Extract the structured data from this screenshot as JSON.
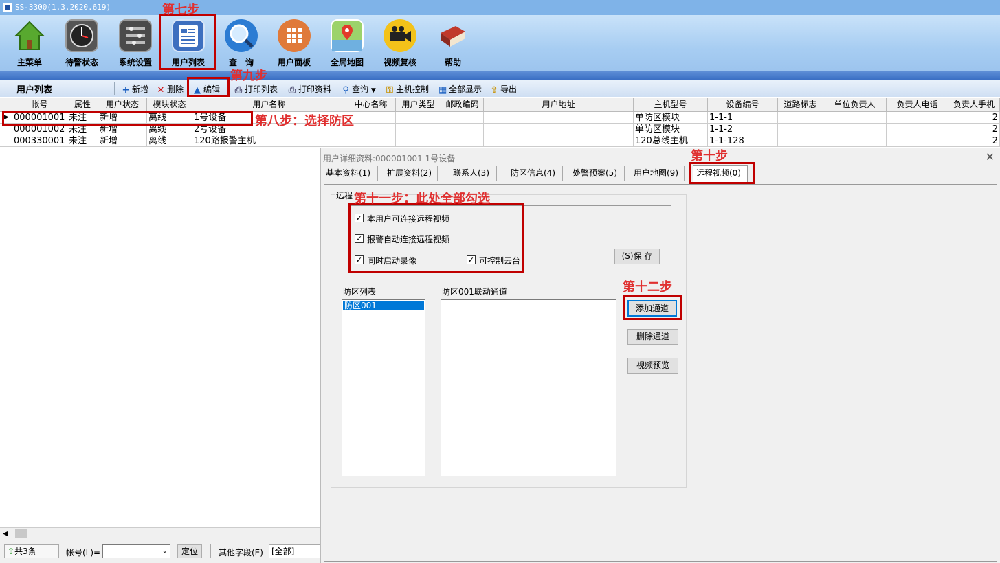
{
  "window": {
    "title": "SS-3300(1.3.2020.619)"
  },
  "ribbon": {
    "items": [
      {
        "label": "主菜单",
        "icon": "home-icon"
      },
      {
        "label": "待警状态",
        "icon": "clock-icon"
      },
      {
        "label": "系统设置",
        "icon": "settings-icon"
      },
      {
        "label": "用户列表",
        "icon": "user-list-icon"
      },
      {
        "label": "查　询",
        "icon": "search-icon"
      },
      {
        "label": "用户面板",
        "icon": "grid-panel-icon"
      },
      {
        "label": "全局地图",
        "icon": "map-icon"
      },
      {
        "label": "视频复核",
        "icon": "video-camera-icon"
      },
      {
        "label": "帮助",
        "icon": "book-icon"
      }
    ]
  },
  "toolbar": {
    "title": "用户列表",
    "buttons": [
      "新增",
      "删除",
      "编辑",
      "打印列表",
      "打印资料",
      "查询",
      "主机控制",
      "全部显示",
      "导出"
    ]
  },
  "grid": {
    "columns": [
      "帐号",
      "属性",
      "用户状态",
      "模块状态",
      "用户名称",
      "中心名称",
      "用户类型",
      "邮政编码",
      "用户地址",
      "主机型号",
      "设备编号",
      "道路标志",
      "单位负责人",
      "负责人电话",
      "负责人手机"
    ],
    "rows": [
      {
        "account": "000001001",
        "attr": "未注",
        "user_status": "新增",
        "module_status": "离线",
        "name": "1号设备",
        "host_model": "单防区模块",
        "device_no": "1-1-1",
        "tail": "2"
      },
      {
        "account": "000001002",
        "attr": "未注",
        "user_status": "新增",
        "module_status": "离线",
        "name": "2号设备",
        "host_model": "单防区模块",
        "device_no": "1-1-2",
        "tail": "2"
      },
      {
        "account": "000330001",
        "attr": "未注",
        "user_status": "新增",
        "module_status": "离线",
        "name": "120路报警主机",
        "host_model": "120总线主机",
        "device_no": "1-1-128",
        "tail": "2"
      }
    ]
  },
  "statusbar": {
    "count": "共3条",
    "account_label": "帐号(L)=",
    "locate_button": "定位",
    "other_field_label": "其他字段(E)",
    "other_field_value": "[全部]"
  },
  "dialog": {
    "title": "用户详细资料:000001001 1号设备",
    "tabs": [
      "基本资料(1)",
      "扩展资料(2)",
      "联系人(3)",
      "防区信息(4)",
      "处警预案(5)",
      "用户地图(9)",
      "远程视频(0)"
    ],
    "group_label": "远程",
    "checkboxes": [
      "本用户可连接远程视频",
      "报警自动连接远程视频",
      "同时启动录像",
      "可控制云台"
    ],
    "save_button": "(S)保 存",
    "zone_list_label": "防区列表",
    "zone_list_items": [
      "防区001"
    ],
    "channel_list_label": "防区001联动通道",
    "add_channel_button": "添加通道",
    "delete_channel_button": "删除通道",
    "preview_button": "视频预览"
  },
  "annotations": {
    "step7": "第七步",
    "step8": "第八步：选择防区",
    "step9": "第九步",
    "step10": "第十步",
    "step11": "第十一步：此处全部勾选",
    "step12": "第十二步"
  },
  "colors": {
    "annotation": "#e03030",
    "highlight_box": "#c00000",
    "selection": "#0078d7",
    "title_bar": "#7fb3e8"
  }
}
